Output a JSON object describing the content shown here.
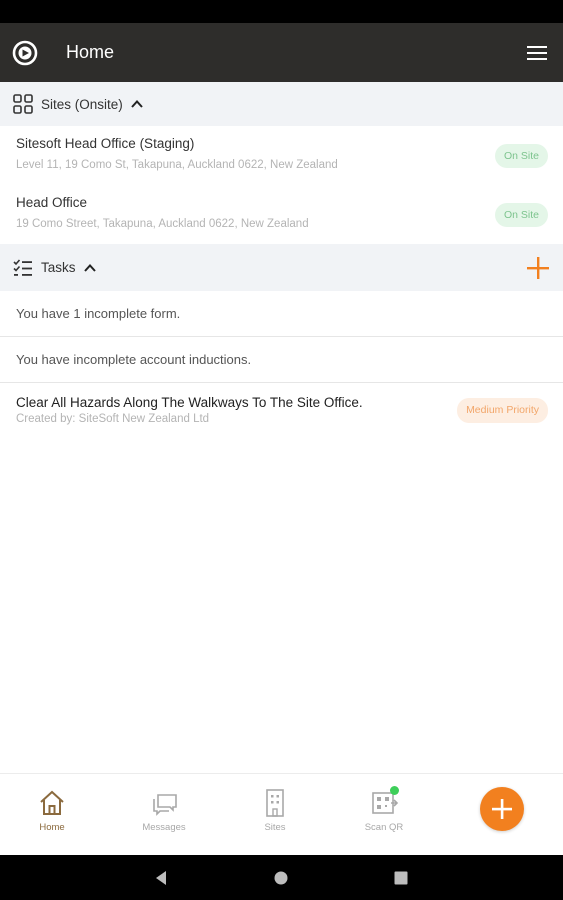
{
  "app": {
    "title": "Home"
  },
  "sites": {
    "header": "Sites (Onsite)",
    "items": [
      {
        "name": "Sitesoft Head Office (Staging)",
        "address": "Level 11, 19 Como St, Takapuna, Auckland 0622, New Zealand",
        "status": "On Site"
      },
      {
        "name": "Head Office",
        "address": "19 Como Street, Takapuna, Auckland 0622, New Zealand",
        "status": "On Site"
      }
    ]
  },
  "tasks": {
    "header": "Tasks",
    "items": [
      {
        "text": "You have 1 incomplete form."
      },
      {
        "text": "You have incomplete account inductions."
      }
    ],
    "hazard": {
      "title": "Clear All Hazards Along The Walkways To The Site Office.",
      "creator": "Created by: SiteSoft New Zealand Ltd",
      "priority": "Medium Priority"
    }
  },
  "bottom_nav": {
    "items": [
      {
        "label": "Home",
        "icon": "home-icon",
        "active": true
      },
      {
        "label": "Messages",
        "icon": "messages-icon"
      },
      {
        "label": "Sites",
        "icon": "building-icon"
      },
      {
        "label": "Scan QR",
        "icon": "qr-scan-icon"
      }
    ],
    "fab_icon": "plus-icon"
  },
  "colors": {
    "app_bar": "#2e2d2b",
    "accent": "#f2801f",
    "active_nav": "#8b6a3e",
    "on_site_badge_bg": "#e4f6e8",
    "on_site_badge_text": "#7dc48e",
    "priority_badge_bg": "#fdeee2",
    "priority_badge_text": "#f2a66a",
    "notification_dot": "#3ecf5a"
  }
}
